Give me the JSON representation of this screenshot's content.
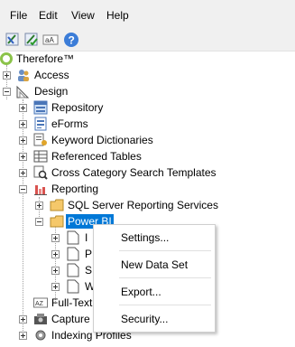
{
  "menu": {
    "file": "File",
    "edit": "Edit",
    "view": "View",
    "help": "Help"
  },
  "toolbar": {
    "icons": [
      "designer-icon",
      "designer-check-icon",
      "rename-icon",
      "help-icon"
    ],
    "rename_text": "aA"
  },
  "tree": {
    "root": "Therefore™",
    "access": "Access",
    "design": "Design",
    "design_children": {
      "repository": "Repository",
      "eforms": "eForms",
      "keyword_dictionaries": "Keyword Dictionaries",
      "referenced_tables": "Referenced Tables",
      "cross_category": "Cross Category Search Templates",
      "reporting": "Reporting"
    },
    "reporting_children": {
      "ssrs": "SQL Server Reporting Services",
      "powerbi": "Power BI"
    },
    "powerbi_children_partial": [
      "I",
      "P",
      "S",
      "W"
    ],
    "fulltext": "Full-Text",
    "capture": "Capture",
    "indexing": "Indexing Profiles",
    "fulltext_badge": "AZ"
  },
  "context_menu": {
    "settings": "Settings...",
    "new_data_set": "New Data Set",
    "export": "Export...",
    "security": "Security..."
  },
  "colors": {
    "selection": "#0078d7",
    "root_icon": "#8bc34a",
    "reporting_icon": "#d9534f",
    "folder": "#f5c86a"
  }
}
